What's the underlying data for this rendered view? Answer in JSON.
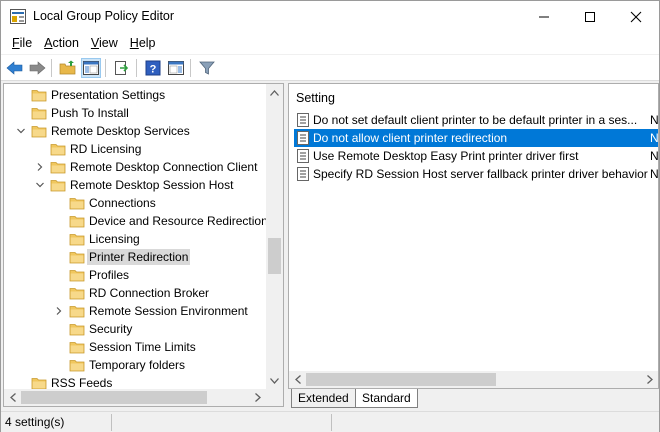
{
  "window": {
    "title": "Local Group Policy Editor"
  },
  "menu": [
    {
      "label": "File",
      "ul": "F",
      "rest": "ile"
    },
    {
      "label": "Action",
      "ul": "A",
      "rest": "ction"
    },
    {
      "label": "View",
      "ul": "V",
      "rest": "iew"
    },
    {
      "label": "Help",
      "ul": "H",
      "rest": "elp"
    }
  ],
  "toolbar": {
    "buttons": [
      "back-icon",
      "forward-icon",
      "up-folder-icon",
      "show-hide-tree-icon",
      "export-list-icon",
      "help-icon",
      "show-hide-action-pane-icon",
      "filter-icon"
    ]
  },
  "tree": [
    {
      "label": "Presentation Settings",
      "indent": 0,
      "expander": "none",
      "selected": false
    },
    {
      "label": "Push To Install",
      "indent": 0,
      "expander": "none",
      "selected": false
    },
    {
      "label": "Remote Desktop Services",
      "indent": 0,
      "expander": "expanded",
      "selected": false
    },
    {
      "label": "RD Licensing",
      "indent": 1,
      "expander": "none",
      "selected": false
    },
    {
      "label": "Remote Desktop Connection Client",
      "indent": 1,
      "expander": "collapsed",
      "selected": false
    },
    {
      "label": "Remote Desktop Session Host",
      "indent": 1,
      "expander": "expanded",
      "selected": false
    },
    {
      "label": "Connections",
      "indent": 2,
      "expander": "none",
      "selected": false
    },
    {
      "label": "Device and Resource Redirection",
      "indent": 2,
      "expander": "none",
      "selected": false
    },
    {
      "label": "Licensing",
      "indent": 2,
      "expander": "none",
      "selected": false
    },
    {
      "label": "Printer Redirection",
      "indent": 2,
      "expander": "none",
      "selected": true
    },
    {
      "label": "Profiles",
      "indent": 2,
      "expander": "none",
      "selected": false
    },
    {
      "label": "RD Connection Broker",
      "indent": 2,
      "expander": "none",
      "selected": false
    },
    {
      "label": "Remote Session Environment",
      "indent": 2,
      "expander": "collapsed",
      "selected": false
    },
    {
      "label": "Security",
      "indent": 2,
      "expander": "none",
      "selected": false
    },
    {
      "label": "Session Time Limits",
      "indent": 2,
      "expander": "none",
      "selected": false
    },
    {
      "label": "Temporary folders",
      "indent": 2,
      "expander": "none",
      "selected": false
    },
    {
      "label": "RSS Feeds",
      "indent": 0,
      "expander": "none",
      "selected": false
    }
  ],
  "list": {
    "column_header": "Setting",
    "rows": [
      {
        "name": "Do not set default client printer to be default printer in a ses...",
        "state": "N",
        "selected": false
      },
      {
        "name": "Do not allow client printer redirection",
        "state": "N",
        "selected": true
      },
      {
        "name": "Use Remote Desktop Easy Print printer driver first",
        "state": "N",
        "selected": false
      },
      {
        "name": "Specify RD Session Host server fallback printer driver behavior",
        "state": "N",
        "selected": false
      }
    ]
  },
  "tabs": {
    "extended": "Extended",
    "standard": "Standard"
  },
  "status": {
    "text": "4 setting(s)"
  },
  "colors": {
    "selection": "#0078d7",
    "tree_selection": "#d9d9d9",
    "folder": "#f0c75e"
  }
}
